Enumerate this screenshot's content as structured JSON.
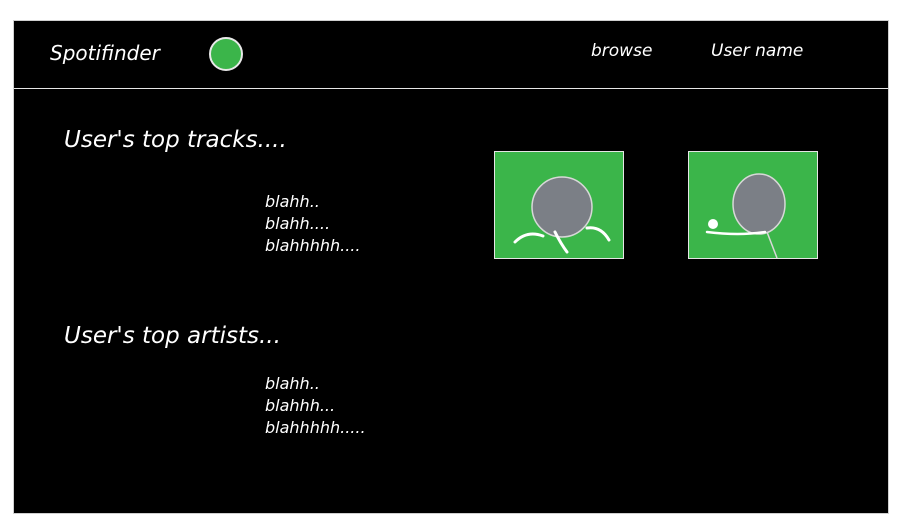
{
  "header": {
    "app_title": "Spotifinder",
    "nav": {
      "browse": "browse",
      "user": "User name"
    }
  },
  "tracks": {
    "title": "User's top tracks....",
    "items": [
      "blahh..",
      "blahh....",
      "blahhhhh...."
    ]
  },
  "artists": {
    "title": "User's top artists...",
    "items": [
      "blahh..",
      "blahhh...",
      "blahhhhh....."
    ]
  },
  "colors": {
    "background": "#000000",
    "accent_green": "#3bb54a",
    "avatar_gray": "#7b7f86",
    "text": "#ffffff"
  },
  "icons": [
    "logo-dot-icon",
    "user-avatar-icon",
    "user-avatar-icon"
  ]
}
